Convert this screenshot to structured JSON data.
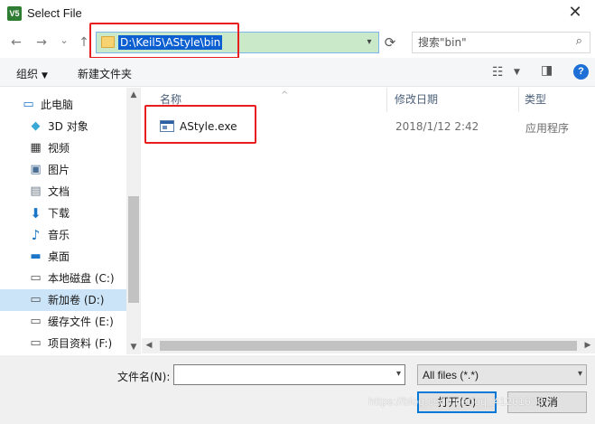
{
  "window": {
    "title": "Select File",
    "app_icon_label": "V5",
    "close_glyph": "✕"
  },
  "navigation": {
    "back_glyph": "←",
    "forward_glyph": "→",
    "recent_glyph": "⌄",
    "up_glyph": "↑",
    "address_path": "D:\\Keil5\\AStyle\\bin",
    "refresh_glyph": "⟳",
    "search_placeholder": "搜索\"bin\""
  },
  "toolbar": {
    "organize_label": "组织",
    "new_folder_label": "新建文件夹"
  },
  "sidebar": {
    "items": [
      {
        "label": "此电脑",
        "icon": "computer-icon"
      },
      {
        "label": "3D 对象",
        "icon": "3d-objects-icon"
      },
      {
        "label": "视频",
        "icon": "video-icon"
      },
      {
        "label": "图片",
        "icon": "pictures-icon"
      },
      {
        "label": "文档",
        "icon": "documents-icon"
      },
      {
        "label": "下载",
        "icon": "downloads-icon"
      },
      {
        "label": "音乐",
        "icon": "music-icon"
      },
      {
        "label": "桌面",
        "icon": "desktop-icon"
      },
      {
        "label": "本地磁盘 (C:)",
        "icon": "drive-icon"
      },
      {
        "label": "新加卷 (D:)",
        "icon": "drive-icon",
        "selected": true
      },
      {
        "label": "缓存文件 (E:)",
        "icon": "drive-icon"
      },
      {
        "label": "项目资料 (F:)",
        "icon": "drive-icon"
      }
    ]
  },
  "file_list": {
    "columns": [
      "名称",
      "修改日期",
      "类型"
    ],
    "rows": [
      {
        "name": "AStyle.exe",
        "modified": "2018/1/12 2:42",
        "type": "应用程序"
      }
    ]
  },
  "bottom": {
    "filename_label": "文件名(N):",
    "filename_value": "",
    "filter_value": "All files (*.*)",
    "open_label": "打开(O)",
    "cancel_label": "取消",
    "watermark": "https://blog.csdn.net/qq_41261678"
  },
  "colors": {
    "highlight": "#e81e1e",
    "selection": "#cce4f7",
    "address_selection": "#0b5fd1",
    "address_bg": "#c9e9c9"
  }
}
